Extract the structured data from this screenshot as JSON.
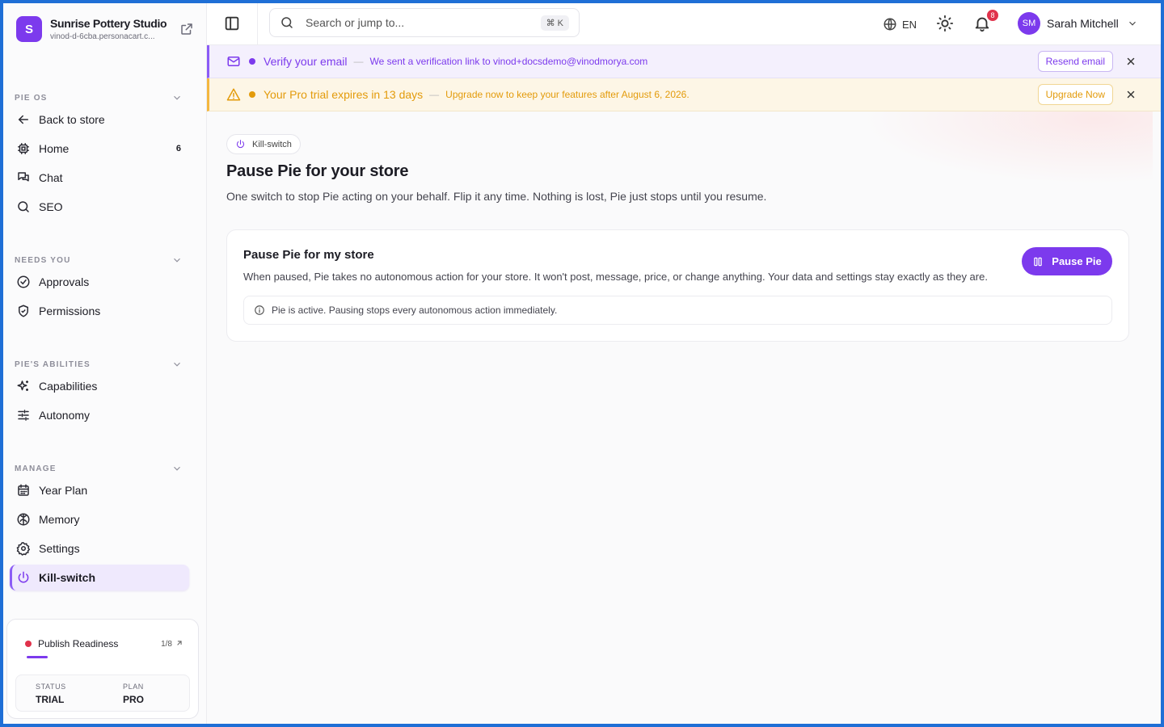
{
  "brand": {
    "initial": "S",
    "name": "Sunrise Pottery Studio",
    "url": "vinod-d-6cba.personacart.c..."
  },
  "sidebar": {
    "sections": [
      {
        "title": "PIE OS",
        "items": [
          {
            "label": "Back to store",
            "icon": "arrow-left-icon"
          },
          {
            "label": "Home",
            "icon": "chip-icon",
            "count": "6"
          },
          {
            "label": "Chat",
            "icon": "chat-icon"
          },
          {
            "label": "SEO",
            "icon": "search-icon"
          }
        ]
      },
      {
        "title": "NEEDS YOU",
        "items": [
          {
            "label": "Approvals",
            "icon": "check-circle-icon"
          },
          {
            "label": "Permissions",
            "icon": "shield-check-icon"
          }
        ]
      },
      {
        "title": "PIE'S ABILITIES",
        "items": [
          {
            "label": "Capabilities",
            "icon": "sparkles-icon"
          },
          {
            "label": "Autonomy",
            "icon": "sliders-icon"
          }
        ]
      },
      {
        "title": "MANAGE",
        "items": [
          {
            "label": "Year Plan",
            "icon": "calendar-icon"
          },
          {
            "label": "Memory",
            "icon": "brain-icon"
          },
          {
            "label": "Settings",
            "icon": "gear-icon"
          },
          {
            "label": "Kill-switch",
            "icon": "power-icon",
            "active": true
          }
        ]
      }
    ],
    "readiness": {
      "label": "Publish Readiness",
      "fraction": "1/8",
      "progress": 0.125,
      "status_label": "STATUS",
      "status_value": "TRIAL",
      "plan_label": "PLAN",
      "plan_value": "PRO"
    }
  },
  "topbar": {
    "search_placeholder": "Search or jump to...",
    "shortcut": "⌘ K",
    "language": "EN",
    "notifications_count": "8",
    "user": {
      "initials": "SM",
      "name": "Sarah Mitchell"
    }
  },
  "banners": {
    "verify": {
      "title": "Verify your email",
      "separator": "—",
      "message": "We sent a verification link to vinod+docsdemo@vinodmorya.com",
      "action": "Resend email",
      "color": "#7c3aed"
    },
    "trial": {
      "title": "Your Pro trial expires in 13 days",
      "separator": "—",
      "message": "Upgrade now to keep your features after August 6, 2026.",
      "action": "Upgrade Now",
      "color": "#e39b0b"
    }
  },
  "main": {
    "chip": "Kill-switch",
    "title": "Pause Pie for your store",
    "subtitle": "One switch to stop Pie acting on your behalf. Flip it any time. Nothing is lost, Pie just stops until you resume.",
    "card": {
      "title": "Pause Pie for my store",
      "description": "When paused, Pie takes no autonomous action for your store. It won't post, message, price, or change anything. Your data and settings stay exactly as they are.",
      "button": "Pause Pie",
      "info": "Pie is active. Pausing stops every autonomous action immediately."
    }
  },
  "colors": {
    "accent": "#7c3aed",
    "warning": "#e39b0b",
    "danger": "#e0324b"
  }
}
